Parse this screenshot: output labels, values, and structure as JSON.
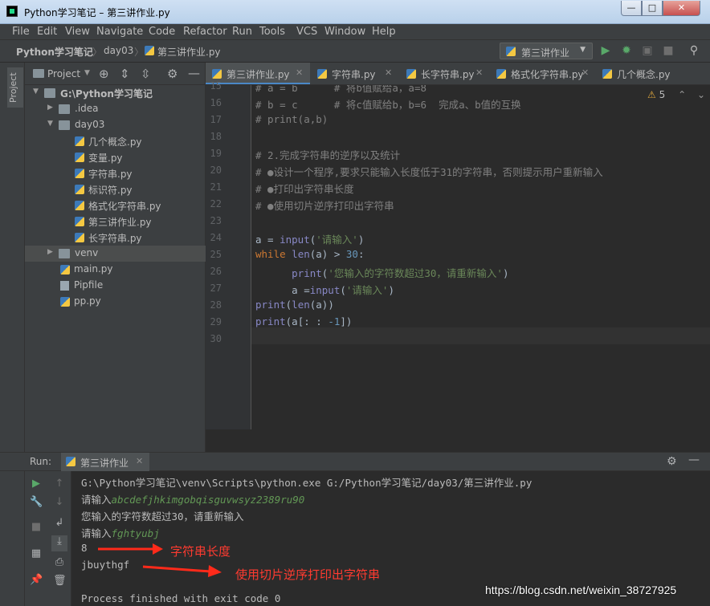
{
  "window": {
    "title": "Python学习笔记 – 第三讲作业.py",
    "minimize_glyph": "—",
    "maximize_glyph": "□",
    "close_glyph": "✕"
  },
  "menu": [
    "File",
    "Edit",
    "View",
    "Navigate",
    "Code",
    "Refactor",
    "Run",
    "Tools",
    "VCS",
    "Window",
    "Help"
  ],
  "breadcrumb": [
    "Python学习笔记",
    "day03",
    "第三讲作业.py"
  ],
  "run_config": {
    "label": "第三讲作业"
  },
  "left_stripe": {
    "project_tab": "Project"
  },
  "project_panel": {
    "header": "Project",
    "tree": [
      {
        "label": "G:\\Python学习笔记",
        "type": "folder",
        "open": true,
        "depth": 0,
        "bold": true
      },
      {
        "label": ".idea",
        "type": "folder",
        "open": false,
        "depth": 1
      },
      {
        "label": "day03",
        "type": "folder",
        "open": true,
        "depth": 1
      },
      {
        "label": "几个概念.py",
        "type": "py",
        "depth": 2
      },
      {
        "label": "变量.py",
        "type": "py",
        "depth": 2
      },
      {
        "label": "字符串.py",
        "type": "py",
        "depth": 2
      },
      {
        "label": "标识符.py",
        "type": "py",
        "depth": 2
      },
      {
        "label": "格式化字符串.py",
        "type": "py",
        "depth": 2
      },
      {
        "label": "第三讲作业.py",
        "type": "py",
        "depth": 2
      },
      {
        "label": "长字符串.py",
        "type": "py",
        "depth": 2
      },
      {
        "label": "venv",
        "type": "folder",
        "open": false,
        "depth": 1,
        "highlight": true
      },
      {
        "label": "main.py",
        "type": "py",
        "depth": 1
      },
      {
        "label": "Pipfile",
        "type": "txt",
        "depth": 1
      },
      {
        "label": "pp.py",
        "type": "py",
        "depth": 1
      }
    ]
  },
  "editor_tabs": [
    {
      "label": "第三讲作业.py",
      "active": true
    },
    {
      "label": "字符串.py",
      "active": false
    },
    {
      "label": "长字符串.py",
      "active": false
    },
    {
      "label": "格式化字符串.py",
      "active": false
    },
    {
      "label": "几个概念.py",
      "active": false
    }
  ],
  "editor": {
    "warnings": "5",
    "line_numbers": [
      "15",
      "16",
      "17",
      "18",
      "19",
      "20",
      "21",
      "22",
      "23",
      "24",
      "25",
      "26",
      "27",
      "28",
      "29",
      "30"
    ],
    "lines": [
      "# a = b      # 将b值赋给a，a=8",
      "# b = c      # 将c值赋给b，b=6  完成a、b值的互换",
      "# print(a,b)",
      "",
      "# 2.完成字符串的逆序以及统计",
      "# ●设计一个程序,要求只能输入长度低于31的字符串，否则提示用户重新输入",
      "# ●打印出字符串长度",
      "# ●使用切片逆序打印出字符串",
      "",
      "a = input('请输入')",
      "while len(a) > 30:",
      "      print('您输入的字符数超过30，请重新输入')",
      "      a =input('请输入')",
      "print(len(a))",
      "print(a[: : -1])",
      ""
    ]
  },
  "run_panel": {
    "label": "Run:",
    "tab": "第三讲作业",
    "console": [
      {
        "text": "G:\\Python学习笔记\\venv\\Scripts\\python.exe G:/Python学习笔记/day03/第三讲作业.py",
        "input": ""
      },
      {
        "text": "请输入",
        "input": "abcdefjhkimgobqisguvwsyz2389ru90"
      },
      {
        "text": "您输入的字符数超过30，请重新输入",
        "input": ""
      },
      {
        "text": "请输入",
        "input": "fghtyubj"
      },
      {
        "text": "8",
        "input": ""
      },
      {
        "text": "jbuythgf",
        "input": ""
      },
      {
        "text": "",
        "input": ""
      },
      {
        "text": "Process finished with exit code 0",
        "input": ""
      }
    ],
    "annotations": [
      "字符串长度",
      "使用切片逆序打印出字符串"
    ]
  },
  "watermark": "https://blog.csdn.net/weixin_38727925",
  "colors": {
    "keyword": "#cc7832",
    "string": "#6a8759",
    "number": "#6897bb",
    "comment": "#808080",
    "builtin": "#8888c6",
    "annotation": "#ff3b30",
    "console_input": "#629755"
  }
}
